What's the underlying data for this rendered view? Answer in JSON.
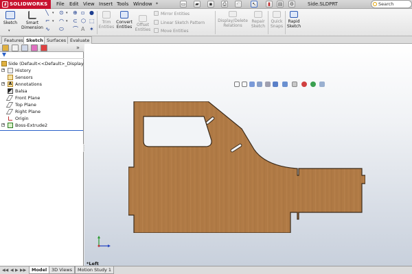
{
  "app": {
    "name": "SOLIDWORKS",
    "document_title": "Side.SLDPRT"
  },
  "menu": [
    "File",
    "Edit",
    "View",
    "Insert",
    "Tools",
    "Window"
  ],
  "search": {
    "placeholder": "Search SOLIDW"
  },
  "ribbon": {
    "sketch_label": "Sketch",
    "smart_dimension_label_1": "Smart",
    "smart_dimension_label_2": "Dimension",
    "trim_label_1": "Trim",
    "trim_label_2": "Entities",
    "convert_label_1": "Convert",
    "convert_label_2": "Entities",
    "offset_label_1": "Offset",
    "offset_label_2": "Entities",
    "mirror_label": "Mirror Entities",
    "linear_pattern_label": "Linear Sketch Pattern",
    "move_label": "Move Entities",
    "display_delete_label_1": "Display/Delete",
    "display_delete_label_2": "Relations",
    "repair_label_1": "Repair",
    "repair_label_2": "Sketch",
    "quick_snaps_label_1": "Quick",
    "quick_snaps_label_2": "Snaps",
    "rapid_sketch_label_1": "Rapid",
    "rapid_sketch_label_2": "Sketch"
  },
  "command_tabs": [
    "Features",
    "Sketch",
    "Surfaces",
    "Evaluate"
  ],
  "active_command_tab": "Sketch",
  "feature_tree": {
    "root": "Side  (Default<<Default>_Display Sta",
    "items": [
      {
        "label": "History",
        "icon": "history-icon",
        "expandable": true
      },
      {
        "label": "Sensors",
        "icon": "sensors-icon",
        "expandable": false
      },
      {
        "label": "Annotations",
        "icon": "annotations-icon",
        "expandable": true
      },
      {
        "label": "Balsa",
        "icon": "material-icon",
        "expandable": false
      },
      {
        "label": "Front Plane",
        "icon": "plane-icon",
        "expandable": false
      },
      {
        "label": "Top Plane",
        "icon": "plane-icon",
        "expandable": false
      },
      {
        "label": "Right Plane",
        "icon": "plane-icon",
        "expandable": false
      },
      {
        "label": "Origin",
        "icon": "origin-icon",
        "expandable": false
      },
      {
        "label": "Boss-Extrude2",
        "icon": "extrude-icon",
        "expandable": true
      }
    ]
  },
  "viewport": {
    "view_label": "*Left",
    "part_color": "#b07a45"
  },
  "bottom_tabs": [
    "Model",
    "3D Views",
    "Motion Study 1"
  ],
  "active_bottom_tab": "Model",
  "colors": {
    "brand": "#c8102e",
    "accent": "#2a60c8"
  }
}
